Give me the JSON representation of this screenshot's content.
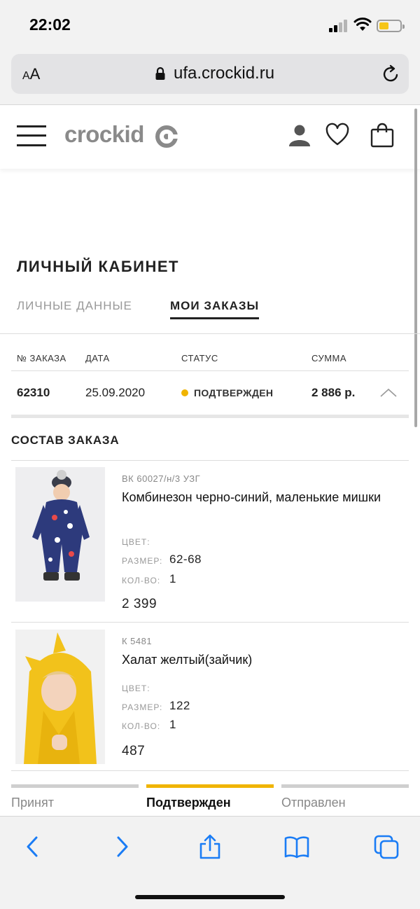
{
  "status_bar": {
    "time": "22:02"
  },
  "browser": {
    "aa_label_small": "A",
    "aa_label_big": "A",
    "url": "ufa.crockid.ru"
  },
  "site": {
    "logo_text": "crockid"
  },
  "account": {
    "title": "ЛИЧНЫЙ КАБИНЕТ",
    "tabs": [
      {
        "label": "ЛИЧНЫЕ ДАННЫЕ",
        "active": false
      },
      {
        "label": "МОИ ЗАКАЗЫ",
        "active": true
      }
    ]
  },
  "orders_table": {
    "headers": [
      "№ ЗАКАЗА",
      "ДАТА",
      "СТАТУС",
      "СУММА"
    ],
    "rows": [
      {
        "number": "62310",
        "date": "25.09.2020",
        "status": "ПОДТВЕРЖДЕН",
        "status_color": "#f0b400",
        "sum": "2 886 р."
      }
    ]
  },
  "order_contents": {
    "title": "СОСТАВ ЗАКАЗА",
    "items": [
      {
        "sku": "ВК 60027/н/3 УЗГ",
        "name": "Комбинезон черно-синий, маленькие мишки",
        "color_label": "ЦВЕТ:",
        "color_value": "",
        "size_label": "РАЗМЕР:",
        "size_value": "62-68",
        "qty_label": "КОЛ-ВО:",
        "qty_value": "1",
        "price": "2 399"
      },
      {
        "sku": "К 5481",
        "name": "Халат желтый(зайчик)",
        "color_label": "ЦВЕТ:",
        "color_value": "",
        "size_label": "РАЗМЕР:",
        "size_value": "122",
        "qty_label": "КОЛ-ВО:",
        "qty_value": "1",
        "price": "487"
      }
    ]
  },
  "progress": {
    "steps": [
      {
        "label": "Принят",
        "active": false
      },
      {
        "label": "Подтвержден",
        "active": true
      },
      {
        "label": "Отправлен",
        "active": false
      }
    ],
    "active_color": "#f0b400",
    "inactive_color": "#cfcfcf"
  },
  "toolbar_icons": [
    "back-icon",
    "forward-icon",
    "share-icon",
    "bookmarks-icon",
    "tabs-icon"
  ]
}
